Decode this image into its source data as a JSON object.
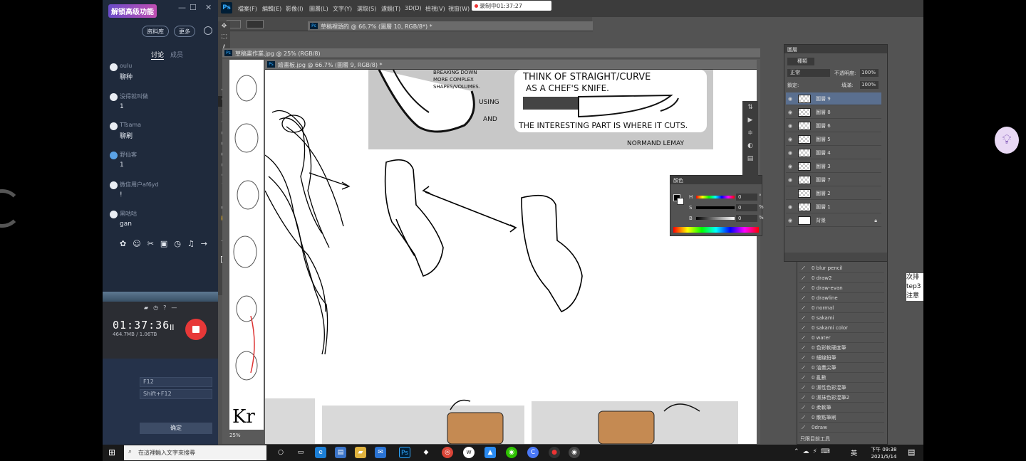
{
  "chat": {
    "brand": "解锁高级功能",
    "window_controls": [
      "—",
      "☐",
      "✕"
    ],
    "buttons": [
      "资料库",
      "更多"
    ],
    "tabs": [
      "讨论",
      "成员"
    ],
    "messages": [
      {
        "nick": "oulu",
        "text": "聊种"
      },
      {
        "nick": "没得就叫做",
        "text": "1"
      },
      {
        "nick": "TTsama",
        "text": "聊刷"
      },
      {
        "nick": "野仙客",
        "text": "1"
      },
      {
        "nick": "微信用户af6yd",
        "text": "!"
      },
      {
        "nick": "黑咕咕",
        "text": "gan"
      }
    ],
    "shortcuts": [
      "F12",
      "Shift+F12"
    ],
    "ok_label": "确定"
  },
  "recorder": {
    "time": "01:37:36",
    "size": "464.7MB / 1.06TB",
    "pause": "II"
  },
  "photoshop": {
    "menus": [
      "檔案(F)",
      "編輯(E)",
      "影像(I)",
      "圖層(L)",
      "文字(Y)",
      "選取(S)",
      "濾鏡(T)",
      "3D(D)",
      "檢視(V)",
      "視窗(W)"
    ],
    "recording": "录制中01:37:27",
    "doc_tabs": {
      "back": "草稿裡頭的 @ 66.7% (圖層 10, RGB/8*) *",
      "mid": "草稿畫作業.jpg @ 25% (RGB/8)",
      "front": "繪畫板.jpg @ 66.7% (圖層 9, RGB/8) *"
    },
    "mid_zoom": "25%",
    "sketch_caption": {
      "line1": "THINK OF STRAIGHT/CURVE",
      "line2": "AS A CHEF'S KNIFE.",
      "line3": "THE INTERESTING PART IS WHERE IT CUTS.",
      "author": "NORMAND LEMAY",
      "left1": "BREAKING DOWN",
      "left2": "MORE COMPLEX",
      "left3": "SHAPES/VOLUMES.",
      "using": "USING",
      "and": "AND"
    },
    "layers_panel": {
      "title": "圖層",
      "kind": "種類",
      "mode": "正常",
      "opacity_label": "不透明度:",
      "opacity": "100%",
      "fill_label": "填滿:",
      "fill": "100%",
      "lock_label": "鎖定:",
      "layers": [
        "圖層 9",
        "圖層 8",
        "圖層 6",
        "圖層 5",
        "圖層 4",
        "圖層 3",
        "圖層 7",
        "圖層 2",
        "圖層 1",
        "背景"
      ]
    },
    "color_panel": {
      "title": "顏色",
      "channels": [
        "H",
        "S",
        "B"
      ],
      "values": [
        "0",
        "0",
        "0"
      ],
      "units": [
        "°",
        "%",
        "%"
      ]
    },
    "brushes": [
      "0 blur pencil",
      "0 draw2",
      "0 draw-evan",
      "0 drawline",
      "0 normal",
      "0 sakami",
      "0 sakami color",
      "0 water",
      "0 色彩軟硬度筆",
      "0 細線鉛筆",
      "0 油畫尖筆",
      "0 亂數",
      "0 濕性色彩混筆",
      "0 濕抹色彩混筆2",
      "0 柔軟筆",
      "0 散點筆刷",
      "0draw"
    ],
    "brush_footer": "只限目前工具"
  },
  "desktop": {
    "partial_text": "次排 tep3 注意"
  },
  "taskbar": {
    "search_placeholder": "在這裡輸入文字來搜尋",
    "ime": "英",
    "time": "下午 09:38",
    "date": "2021/5/14"
  }
}
